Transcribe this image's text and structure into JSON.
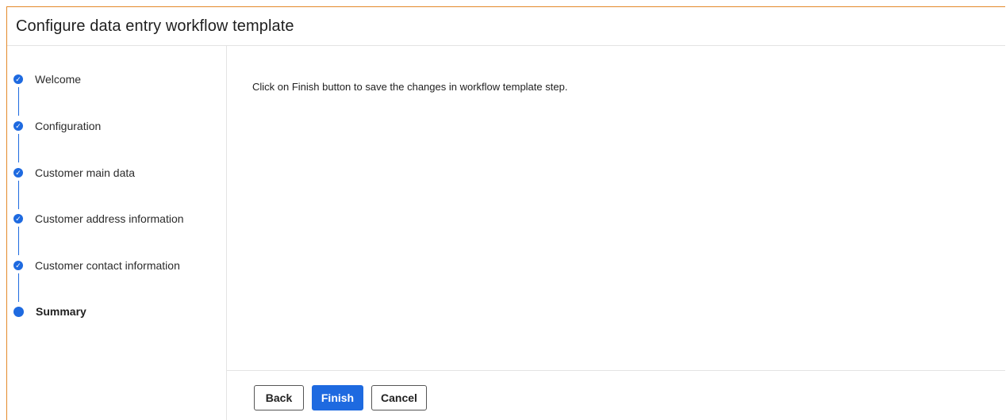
{
  "dialog": {
    "title": "Configure data entry workflow template"
  },
  "steps": [
    {
      "label": "Welcome",
      "status": "completed",
      "icon": "check-icon"
    },
    {
      "label": "Configuration",
      "status": "completed",
      "icon": "check-icon"
    },
    {
      "label": "Customer main data",
      "status": "completed",
      "icon": "check-icon"
    },
    {
      "label": "Customer address information",
      "status": "completed",
      "icon": "check-icon"
    },
    {
      "label": "Customer contact information",
      "status": "completed",
      "icon": "check-icon"
    },
    {
      "label": "Summary",
      "status": "current",
      "icon": "current-step-dot"
    }
  ],
  "content": {
    "message": "Click on Finish button to save the changes in workflow template step."
  },
  "footer": {
    "back_label": "Back",
    "finish_label": "Finish",
    "cancel_label": "Cancel"
  },
  "colors": {
    "accent": "#1e6ae0",
    "dialog_border": "#e48a2b",
    "divider": "#e3e3e3"
  }
}
